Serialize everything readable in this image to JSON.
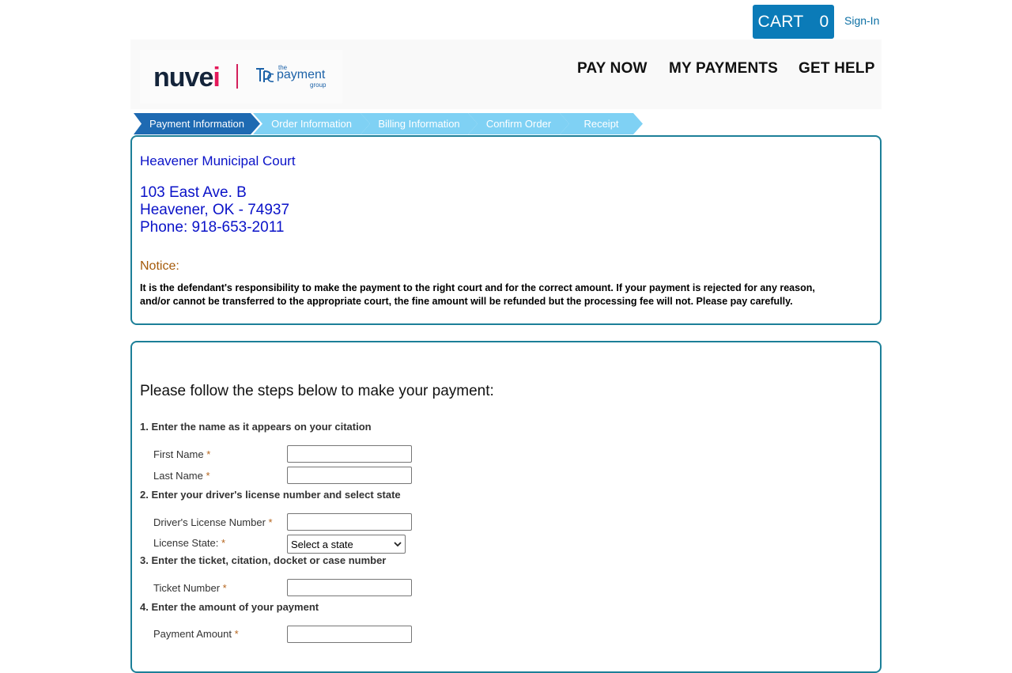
{
  "topbar": {
    "cart_label": "CART",
    "cart_count": "0",
    "signin_label": "Sign-In"
  },
  "brand": {
    "nuvei": "nuve",
    "nuvei_i": "i",
    "tpg_the": "the",
    "tpg_payment": "payment",
    "tpg_group": "group"
  },
  "nav": {
    "pay_now": "PAY NOW",
    "my_payments": "MY PAYMENTS",
    "get_help": "GET HELP"
  },
  "steps": [
    {
      "label": "Payment Information",
      "active": true
    },
    {
      "label": "Order Information",
      "active": false
    },
    {
      "label": "Billing Information",
      "active": false
    },
    {
      "label": "Confirm Order",
      "active": false
    },
    {
      "label": "Receipt",
      "active": false
    }
  ],
  "court": {
    "name": "Heavener Municipal Court",
    "address_line1": "103 East Ave. B",
    "address_line2": "Heavener, OK - 74937",
    "phone": "Phone: 918-653-2011",
    "notice_label": "Notice:",
    "notice_line1": "It is the defendant's responsibility to make the payment to the right court and for the correct amount. If your payment is rejected for any reason,",
    "notice_line2": "and/or cannot be transferred to the appropriate court, the fine amount will be refunded but the processing fee will not. Please pay carefully."
  },
  "form": {
    "instructions": "Please follow the steps below to make your payment:",
    "step1": "1. Enter the name as it appears on your citation",
    "first_name_label": "First Name",
    "last_name_label": "Last Name",
    "step2": "2. Enter your driver's license number and select state",
    "license_label": "Driver's License Number",
    "state_label": "License State:",
    "state_selected": "Select a state",
    "step3": "3. Enter the ticket, citation, docket or case number",
    "ticket_label": "Ticket Number",
    "step4": "4. Enter the amount of your payment",
    "amount_label": "Payment Amount",
    "required_mark": "*"
  },
  "colors": {
    "cart_bg": "#0b7bb8",
    "panel_border": "#1c7f98",
    "court_text": "#0a12c8",
    "notice_label": "#a55a0a",
    "step_active": "#1e6ab2",
    "step_inactive": "#7fd1f4"
  }
}
